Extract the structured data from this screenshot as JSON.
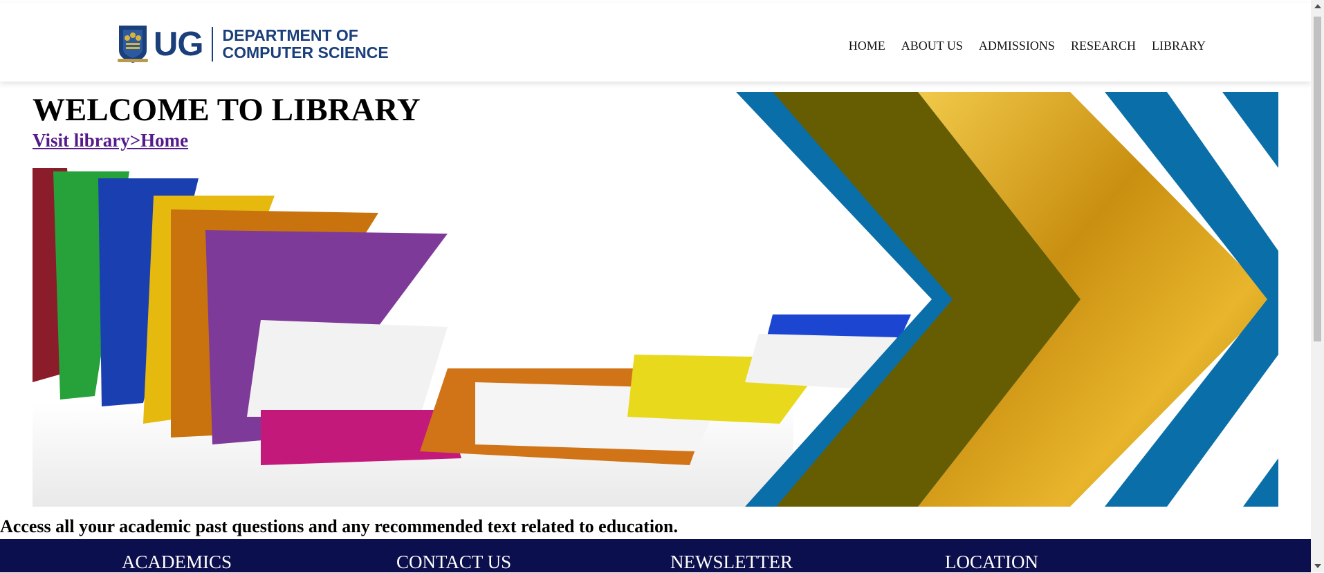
{
  "header": {
    "logo": {
      "short": "UG",
      "line1": "DEPARTMENT OF",
      "line2": "COMPUTER SCIENCE"
    },
    "nav": [
      "HOME",
      "ABOUT US",
      "ADMISSIONS",
      "RESEARCH",
      "LIBRARY"
    ]
  },
  "hero": {
    "title": "WELCOME TO LIBRARY",
    "breadcrumb": "Visit library>Home",
    "image_subject": "stack of colorful books with blue, olive and gold chevron banner",
    "colors": {
      "blue": "#0a6ea8",
      "olive": "#665c02",
      "gold": "#d4a21a",
      "navy": "#0c0f4d"
    }
  },
  "tagline": "Access all your academic past questions and any recommended text related to education.",
  "footer": [
    "ACADEMICS",
    "CONTACT US",
    "NEWSLETTER",
    "LOCATION"
  ]
}
